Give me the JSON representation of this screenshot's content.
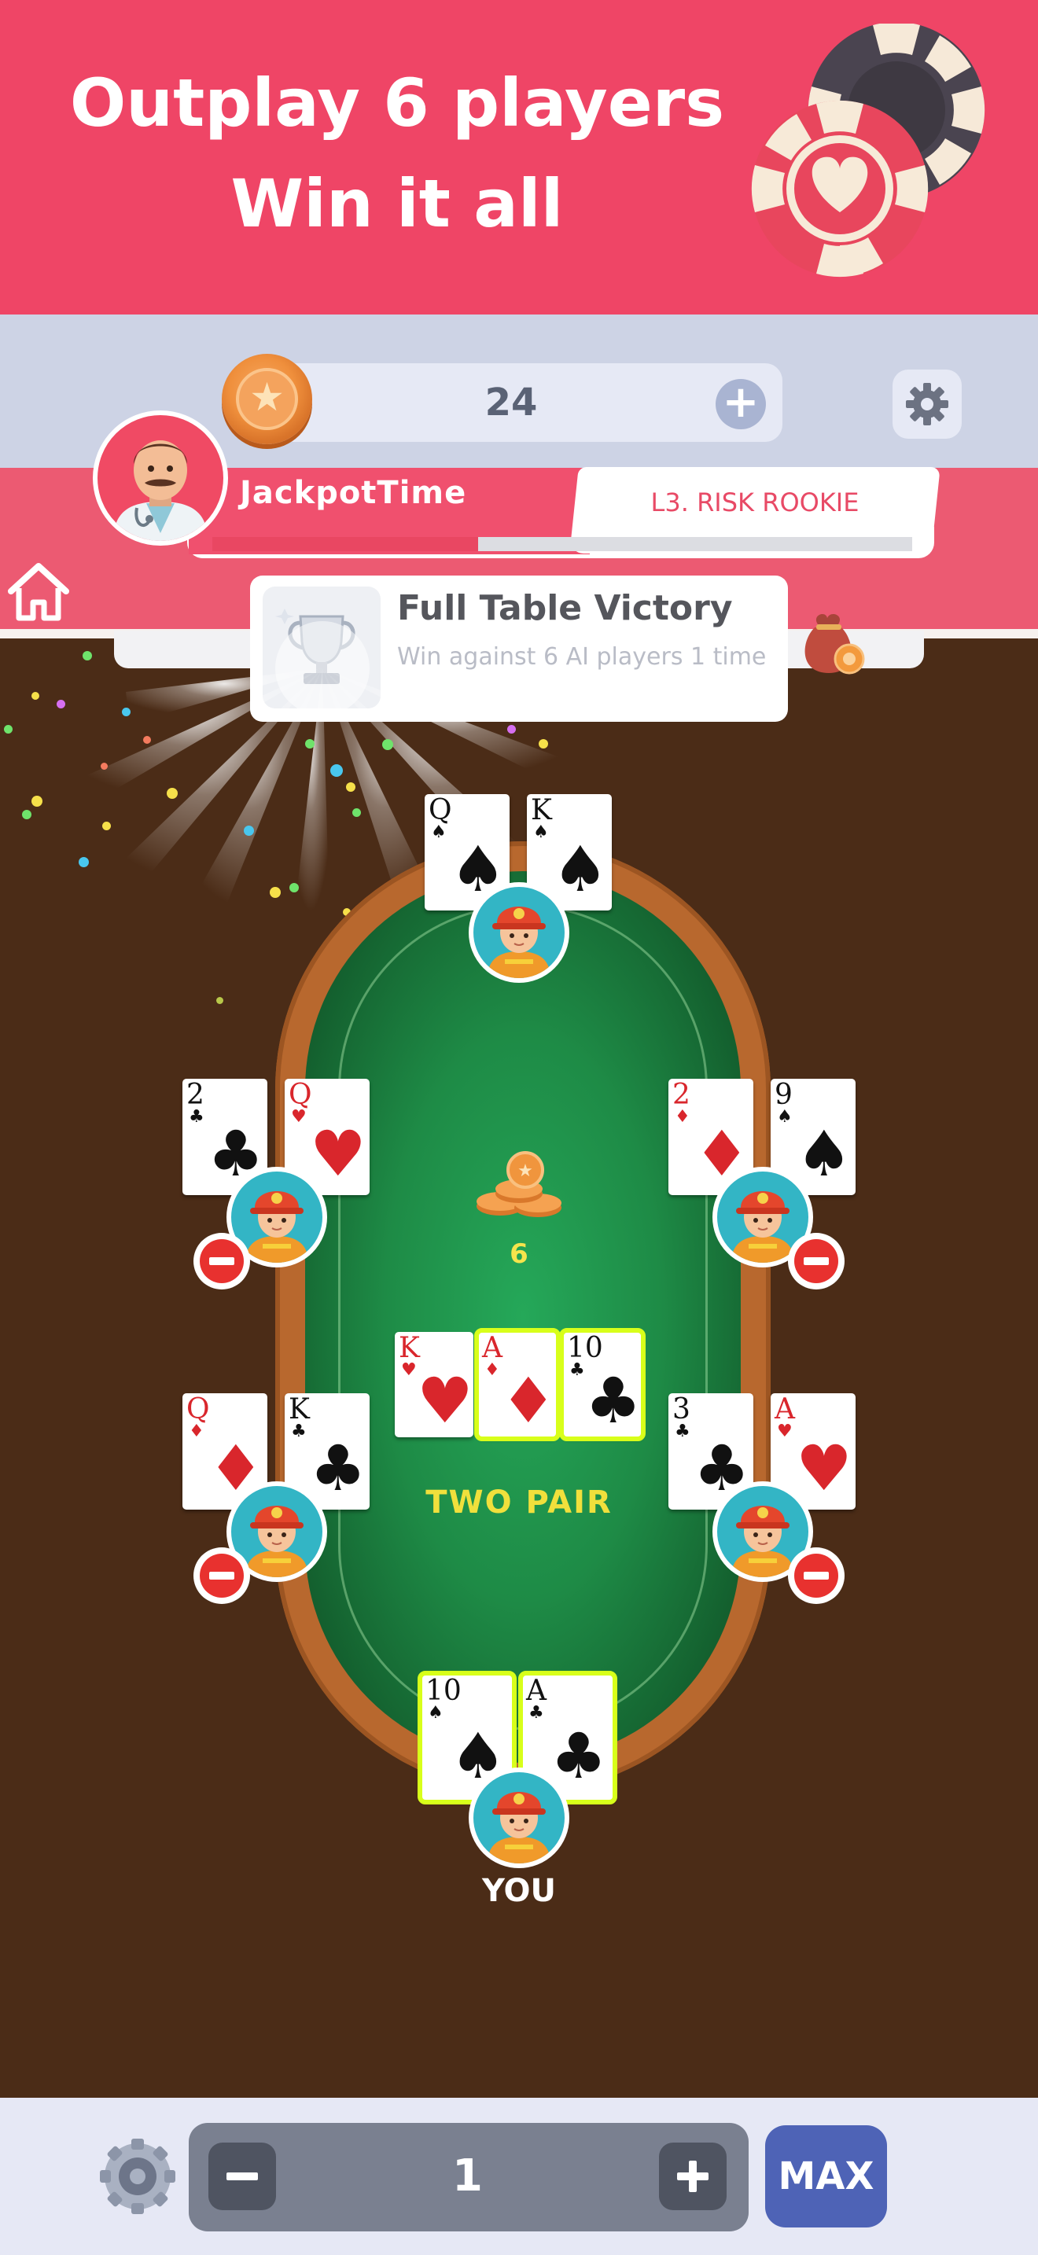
{
  "banner": {
    "line1": "Outplay 6 players",
    "line2": "Win it all"
  },
  "hud": {
    "coins": "24",
    "coin_plus": "+"
  },
  "player": {
    "name": "JackpotTime",
    "rank": "L3. RISK ROOKIE",
    "xp_progress": 0.38
  },
  "achievement": {
    "title": "Full Table Victory",
    "subtitle": "Win against 6 AI players 1 time"
  },
  "table": {
    "pot": "6",
    "hand_label": "TWO PAIR",
    "you_label": "YOU",
    "seats": [
      {
        "id": "top",
        "cards": [
          {
            "rank": "Q",
            "suit": "♠",
            "color": "black"
          },
          {
            "rank": "K",
            "suit": "♠",
            "color": "black"
          }
        ]
      },
      {
        "id": "left-upper",
        "folded": true,
        "cards": [
          {
            "rank": "2",
            "suit": "♣",
            "color": "black"
          },
          {
            "rank": "Q",
            "suit": "♥",
            "color": "red"
          }
        ]
      },
      {
        "id": "right-upper",
        "folded": true,
        "cards": [
          {
            "rank": "2",
            "suit": "♦",
            "color": "red"
          },
          {
            "rank": "9",
            "suit": "♠",
            "color": "black"
          }
        ]
      },
      {
        "id": "left-lower",
        "folded": true,
        "cards": [
          {
            "rank": "Q",
            "suit": "♦",
            "color": "red"
          },
          {
            "rank": "K",
            "suit": "♣",
            "color": "black"
          }
        ]
      },
      {
        "id": "right-lower",
        "folded": true,
        "cards": [
          {
            "rank": "3",
            "suit": "♣",
            "color": "black"
          },
          {
            "rank": "A",
            "suit": "♥",
            "color": "red"
          }
        ]
      },
      {
        "id": "you",
        "cards": [
          {
            "rank": "10",
            "suit": "♠",
            "color": "black"
          },
          {
            "rank": "A",
            "suit": "♣",
            "color": "black"
          }
        ]
      }
    ],
    "community": [
      {
        "rank": "K",
        "suit": "♥",
        "color": "red"
      },
      {
        "rank": "A",
        "suit": "♦",
        "color": "red"
      },
      {
        "rank": "10",
        "suit": "♣",
        "color": "black"
      }
    ]
  },
  "bet": {
    "value": "1",
    "minus": "−",
    "plus": "+",
    "max_label": "MAX"
  },
  "colors": {
    "banner": "#ef4566",
    "felt": "#1e8b46",
    "highlight": "#d8ff1a",
    "max_button": "#4e63b6"
  }
}
